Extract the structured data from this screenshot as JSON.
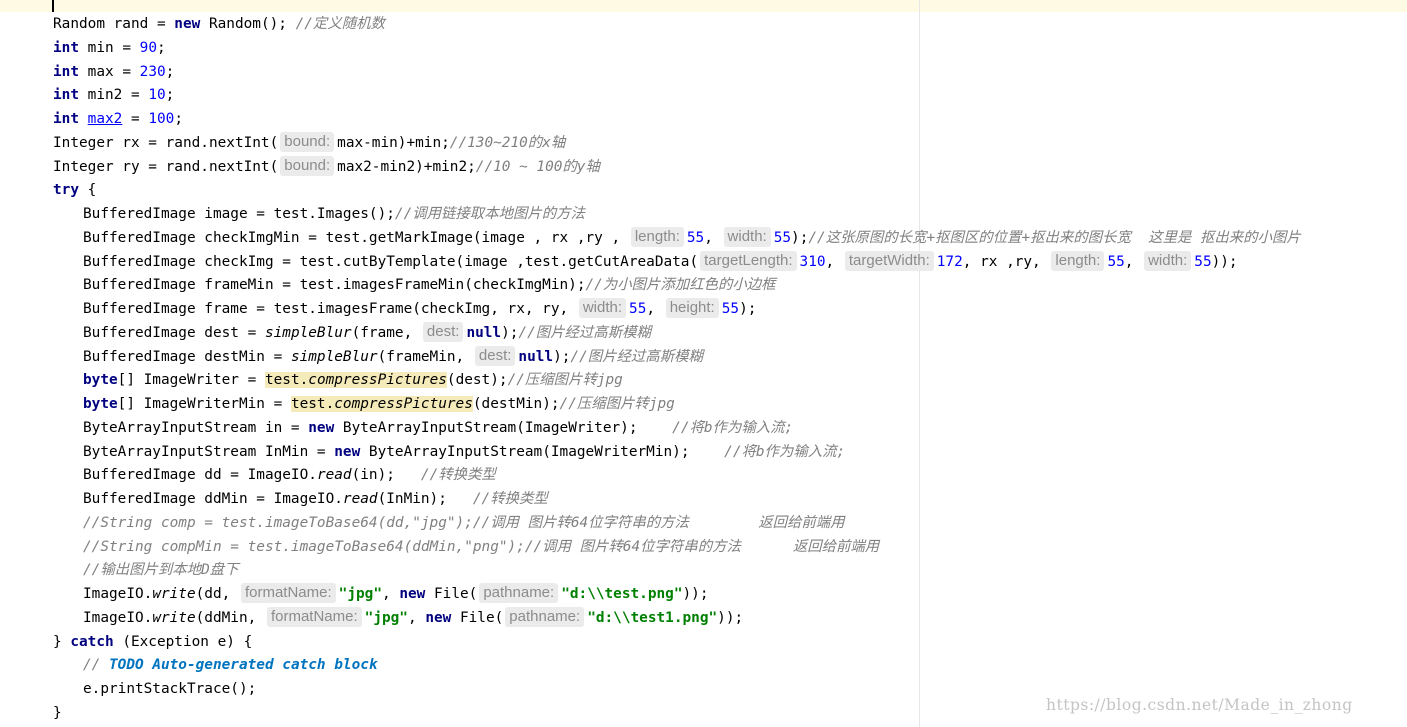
{
  "editor": {
    "watermark": "https://blog.csdn.net/Made_in_zhong",
    "lines": [
      {
        "indent": 0,
        "tokens": [
          [
            "Random rand = ",
            ""
          ],
          [
            "new",
            "kw"
          ],
          [
            " Random(); ",
            ""
          ],
          [
            "//定义随机数",
            "com"
          ]
        ]
      },
      {
        "indent": 0,
        "tokens": [
          [
            "int",
            "kw"
          ],
          [
            " min = ",
            ""
          ],
          [
            "90",
            "num"
          ],
          [
            ";",
            ""
          ]
        ]
      },
      {
        "indent": 0,
        "tokens": [
          [
            "int",
            "kw"
          ],
          [
            " max = ",
            ""
          ],
          [
            "230",
            "num"
          ],
          [
            ";",
            ""
          ]
        ]
      },
      {
        "indent": 0,
        "tokens": [
          [
            "int",
            "kw"
          ],
          [
            " min2 = ",
            ""
          ],
          [
            "10",
            "num"
          ],
          [
            ";",
            ""
          ]
        ]
      },
      {
        "indent": 0,
        "tokens": [
          [
            "int",
            "kw"
          ],
          [
            " ",
            ""
          ],
          [
            "max2",
            "field"
          ],
          [
            " = ",
            ""
          ],
          [
            "100",
            "num"
          ],
          [
            ";",
            ""
          ]
        ]
      },
      {
        "indent": 0,
        "tokens": [
          [
            "Integer rx = rand.nextInt(",
            ""
          ],
          [
            "bound:",
            "hint"
          ],
          [
            "max-min)+min;",
            ""
          ],
          [
            "//130~210的x轴",
            "com"
          ]
        ]
      },
      {
        "indent": 0,
        "tokens": [
          [
            "Integer ry = rand.nextInt(",
            ""
          ],
          [
            "bound:",
            "hint"
          ],
          [
            "max2-min2)+min2;",
            ""
          ],
          [
            "//10 ~ 100的y轴",
            "com"
          ]
        ]
      },
      {
        "indent": 0,
        "tokens": [
          [
            "try",
            "kw"
          ],
          [
            " {",
            ""
          ]
        ]
      },
      {
        "indent": 1,
        "tokens": [
          [
            "BufferedImage image = test.Images();",
            ""
          ],
          [
            "//调用链接取本地图片的方法",
            "com"
          ]
        ]
      },
      {
        "indent": 1,
        "tokens": [
          [
            "BufferedImage checkImgMin = test.getMarkImage(image , rx ,ry , ",
            ""
          ],
          [
            "length:",
            "hint"
          ],
          [
            "55",
            "num"
          ],
          [
            ", ",
            ""
          ],
          [
            "width:",
            "hint"
          ],
          [
            "55",
            "num"
          ],
          [
            ");",
            ""
          ],
          [
            "//这张原图的长宽+抠图区的位置+抠出来的图长宽  这里是 抠出来的小图片",
            "com"
          ]
        ]
      },
      {
        "indent": 1,
        "tokens": [
          [
            "BufferedImage checkImg = test.cutByTemplate(image ,test.getCutAreaData(",
            ""
          ],
          [
            "targetLength:",
            "hint"
          ],
          [
            "310",
            "num"
          ],
          [
            ", ",
            ""
          ],
          [
            "targetWidth:",
            "hint"
          ],
          [
            "172",
            "num"
          ],
          [
            ", rx ,ry, ",
            ""
          ],
          [
            "length:",
            "hint"
          ],
          [
            "55",
            "num"
          ],
          [
            ", ",
            ""
          ],
          [
            "width:",
            "hint"
          ],
          [
            "55",
            "num"
          ],
          [
            "));",
            ""
          ]
        ]
      },
      {
        "indent": 1,
        "tokens": [
          [
            "BufferedImage frameMin = test.imagesFrameMin(checkImgMin);",
            ""
          ],
          [
            "//为小图片添加红色的小边框",
            "com"
          ]
        ]
      },
      {
        "indent": 1,
        "tokens": [
          [
            "BufferedImage frame = test.imagesFrame(checkImg, rx, ry, ",
            ""
          ],
          [
            "width:",
            "hint"
          ],
          [
            "55",
            "num"
          ],
          [
            ", ",
            ""
          ],
          [
            "height:",
            "hint"
          ],
          [
            "55",
            "num"
          ],
          [
            ");",
            ""
          ]
        ]
      },
      {
        "indent": 1,
        "tokens": [
          [
            "BufferedImage dest = ",
            ""
          ],
          [
            "simpleBlur",
            "stat"
          ],
          [
            "(frame, ",
            ""
          ],
          [
            "dest:",
            "hint"
          ],
          [
            "null",
            "kw"
          ],
          [
            ");",
            ""
          ],
          [
            "//图片经过高斯模糊",
            "com"
          ]
        ]
      },
      {
        "indent": 1,
        "tokens": [
          [
            "BufferedImage destMin = ",
            ""
          ],
          [
            "simpleBlur",
            "stat"
          ],
          [
            "(frameMin, ",
            ""
          ],
          [
            "dest:",
            "hint"
          ],
          [
            "null",
            "kw"
          ],
          [
            ");",
            ""
          ],
          [
            "//图片经过高斯模糊",
            "com"
          ]
        ]
      },
      {
        "indent": 1,
        "tokens": [
          [
            "byte",
            "kw"
          ],
          [
            "[] ImageWriter = ",
            ""
          ],
          [
            "test.",
            "hl"
          ],
          [
            "compressPictures",
            "hl stat"
          ],
          [
            "(dest);",
            ""
          ],
          [
            "//压缩图片转jpg",
            "com"
          ]
        ]
      },
      {
        "indent": 1,
        "tokens": [
          [
            "byte",
            "kw"
          ],
          [
            "[] ImageWriterMin = ",
            ""
          ],
          [
            "test.",
            "hl"
          ],
          [
            "compressPictures",
            "hl stat"
          ],
          [
            "(destMin);",
            ""
          ],
          [
            "//压缩图片转jpg",
            "com"
          ]
        ]
      },
      {
        "indent": 1,
        "tokens": [
          [
            "ByteArrayInputStream in = ",
            ""
          ],
          [
            "new",
            "kw"
          ],
          [
            " ByteArrayInputStream(ImageWriter);    ",
            ""
          ],
          [
            "//将b作为输入流;",
            "com"
          ]
        ]
      },
      {
        "indent": 1,
        "tokens": [
          [
            "ByteArrayInputStream InMin = ",
            ""
          ],
          [
            "new",
            "kw"
          ],
          [
            " ByteArrayInputStream(ImageWriterMin);    ",
            ""
          ],
          [
            "//将b作为输入流;",
            "com"
          ]
        ]
      },
      {
        "indent": 1,
        "tokens": [
          [
            "BufferedImage dd = ImageIO.",
            ""
          ],
          [
            "read",
            "stat"
          ],
          [
            "(in);   ",
            ""
          ],
          [
            "//转换类型",
            "com"
          ]
        ]
      },
      {
        "indent": 1,
        "tokens": [
          [
            "BufferedImage ddMin = ImageIO.",
            ""
          ],
          [
            "read",
            "stat"
          ],
          [
            "(InMin);   ",
            ""
          ],
          [
            "//转换类型",
            "com"
          ]
        ]
      },
      {
        "indent": 1,
        "tokens": [
          [
            "//String comp = test.imageToBase64(dd,\"jpg\");//调用 图片转64位字符串的方法        返回给前端用",
            "com"
          ]
        ]
      },
      {
        "indent": 1,
        "tokens": [
          [
            "//String compMin = test.imageToBase64(ddMin,\"png\");//调用 图片转64位字符串的方法      返回给前端用",
            "com"
          ]
        ]
      },
      {
        "indent": 1,
        "tokens": [
          [
            "//输出图片到本地D盘下",
            "com"
          ]
        ]
      },
      {
        "indent": 1,
        "tokens": [
          [
            "ImageIO.",
            ""
          ],
          [
            "write",
            "stat"
          ],
          [
            "(dd, ",
            ""
          ],
          [
            "formatName:",
            "hint"
          ],
          [
            "\"jpg\"",
            "str"
          ],
          [
            ", ",
            ""
          ],
          [
            "new",
            "kw"
          ],
          [
            " File(",
            ""
          ],
          [
            "pathname:",
            "hint"
          ],
          [
            "\"d:\\\\test.png\"",
            "str"
          ],
          [
            "));",
            ""
          ]
        ]
      },
      {
        "indent": 1,
        "tokens": [
          [
            "ImageIO.",
            ""
          ],
          [
            "write",
            "stat"
          ],
          [
            "(ddMin, ",
            ""
          ],
          [
            "formatName:",
            "hint"
          ],
          [
            "\"jpg\"",
            "str"
          ],
          [
            ", ",
            ""
          ],
          [
            "new",
            "kw"
          ],
          [
            " File(",
            ""
          ],
          [
            "pathname:",
            "hint"
          ],
          [
            "\"d:\\\\test1.png\"",
            "str"
          ],
          [
            "));",
            ""
          ]
        ]
      },
      {
        "indent": 0,
        "tokens": [
          [
            "} ",
            ""
          ],
          [
            "catch",
            "kw"
          ],
          [
            " (Exception e) {",
            ""
          ]
        ]
      },
      {
        "indent": 1,
        "tokens": [
          [
            "// ",
            "com"
          ],
          [
            "TODO Auto-generated catch block",
            "todo"
          ]
        ]
      },
      {
        "indent": 1,
        "tokens": [
          [
            "e.printStackTrace();",
            ""
          ]
        ]
      },
      {
        "indent": 0,
        "tokens": [
          [
            "}",
            ""
          ]
        ]
      }
    ]
  }
}
